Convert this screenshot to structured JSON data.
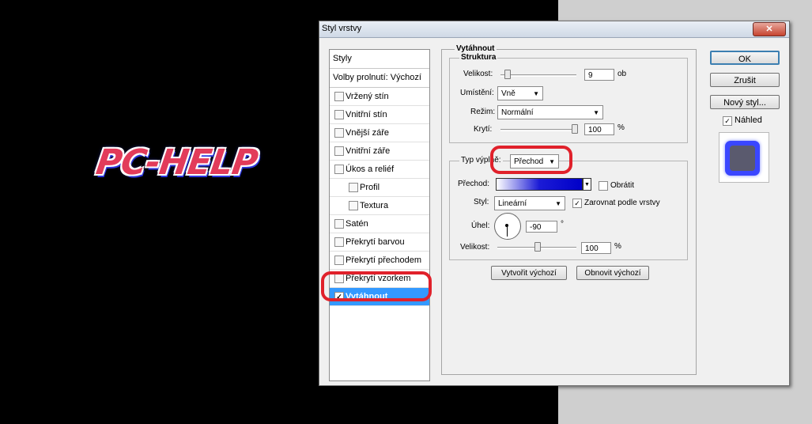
{
  "logo_text": "PC-HELP",
  "dialog": {
    "title": "Styl vrstvy",
    "close": "✕"
  },
  "styles_list": {
    "header": "Styly",
    "blend_options": "Volby prolnutí: Výchozí",
    "items": [
      {
        "label": "Vržený stín",
        "checked": false,
        "indent": 0,
        "selected": false
      },
      {
        "label": "Vnitřní stín",
        "checked": false,
        "indent": 0,
        "selected": false
      },
      {
        "label": "Vnější záře",
        "checked": false,
        "indent": 0,
        "selected": false
      },
      {
        "label": "Vnitřní záře",
        "checked": false,
        "indent": 0,
        "selected": false
      },
      {
        "label": "Úkos a reliéf",
        "checked": false,
        "indent": 0,
        "selected": false
      },
      {
        "label": "Profil",
        "checked": false,
        "indent": 1,
        "selected": false
      },
      {
        "label": "Textura",
        "checked": false,
        "indent": 1,
        "selected": false
      },
      {
        "label": "Satén",
        "checked": false,
        "indent": 0,
        "selected": false
      },
      {
        "label": "Překrytí barvou",
        "checked": false,
        "indent": 0,
        "selected": false
      },
      {
        "label": "Překrytí přechodem",
        "checked": false,
        "indent": 0,
        "selected": false
      },
      {
        "label": "Překrytí vzorkem",
        "checked": false,
        "indent": 0,
        "selected": false
      },
      {
        "label": "Vytáhnout",
        "checked": true,
        "indent": 0,
        "selected": true
      }
    ]
  },
  "stroke": {
    "section": "Vytáhnout",
    "structure": {
      "title": "Struktura",
      "size_label": "Velikost:",
      "size_value": "9",
      "size_unit": "ob",
      "size_slider": 0.05,
      "position_label": "Umístění:",
      "position_value": "Vně",
      "mode_label": "Režim:",
      "mode_value": "Normální",
      "opacity_label": "Krytí:",
      "opacity_value": "100",
      "opacity_unit": "%",
      "opacity_slider": 1.0
    },
    "fill": {
      "type_label": "Typ výplně:",
      "type_value": "Přechod",
      "gradient_label": "Přechod:",
      "reverse_label": "Obrátit",
      "reverse_checked": false,
      "style_label": "Styl:",
      "style_value": "Lineární",
      "align_label": "Zarovnat podle vrstvy",
      "align_checked": true,
      "angle_label": "Úhel:",
      "angle_value": "-90",
      "angle_unit": "°",
      "scale_label": "Velikost:",
      "scale_value": "100",
      "scale_unit": "%",
      "scale_slider": 0.5
    },
    "make_default": "Vytvořit výchozí",
    "reset_default": "Obnovit výchozí"
  },
  "buttons": {
    "ok": "OK",
    "cancel": "Zrušit",
    "new_style": "Nový styl...",
    "preview_label": "Náhled",
    "preview_checked": true
  },
  "colors": {
    "highlight": "#e0212b",
    "selection": "#3399ff"
  }
}
